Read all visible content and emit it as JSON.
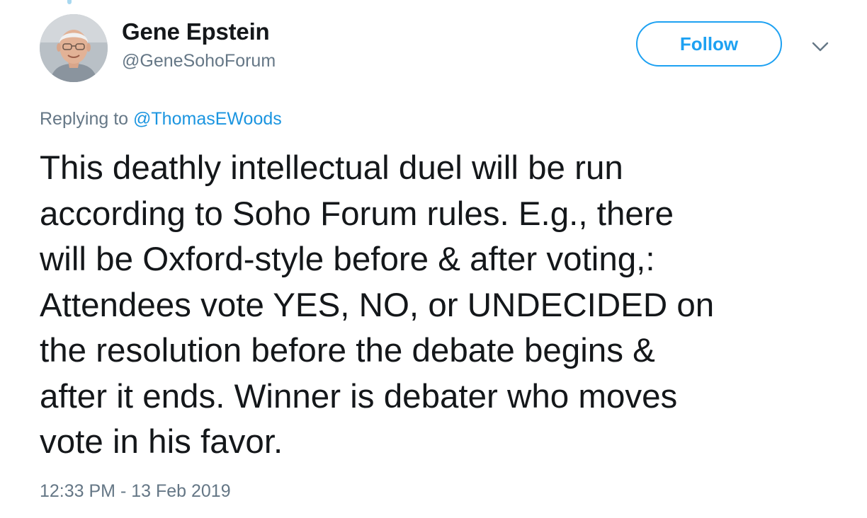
{
  "user": {
    "display_name": "Gene Epstein",
    "handle": "@GeneSohoForum"
  },
  "actions": {
    "follow_label": "Follow",
    "menu_icon": "chevron-down-icon"
  },
  "reply": {
    "prefix": "Replying to ",
    "mention": "@ThomasEWoods"
  },
  "tweet": {
    "lines": [
      "This deathly intellectual duel will be run",
      "according to Soho Forum rules. E.g., there",
      "will be Oxford-style before & after voting,:",
      "Attendees vote YES, NO, or UNDECIDED on",
      "the resolution before the debate begins &",
      "after it ends. Winner is debater who moves",
      "vote in his favor."
    ],
    "timestamp": "12:33 PM - 13 Feb 2019"
  },
  "colors": {
    "accent": "#1da1f2",
    "link": "#1b95e0",
    "secondary_text": "#657786",
    "primary_text": "#14171a"
  }
}
